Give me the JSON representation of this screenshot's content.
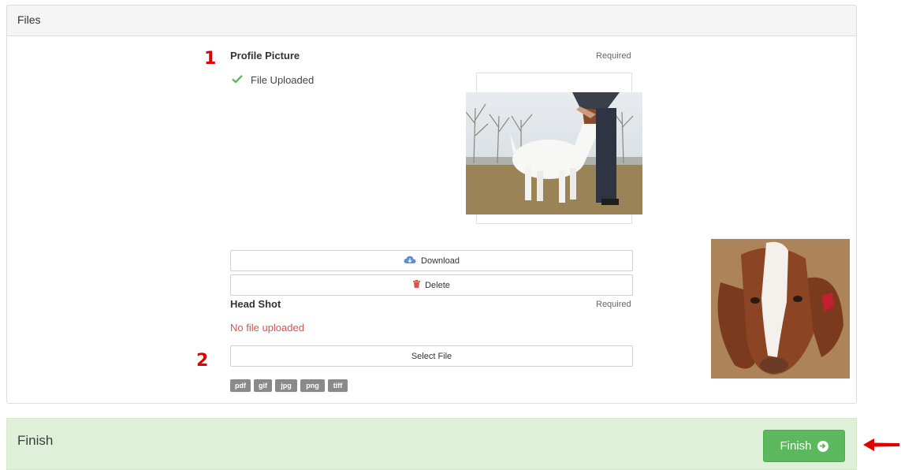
{
  "files_panel": {
    "title": "Files",
    "steps": {
      "one": "1",
      "two": "2"
    },
    "profile_picture": {
      "label": "Profile Picture",
      "required": "Required",
      "status": "File Uploaded",
      "download_label": "Download",
      "delete_label": "Delete"
    },
    "head_shot": {
      "label": "Head Shot",
      "required": "Required",
      "status": "No file uploaded",
      "select_label": "Select File"
    },
    "file_types": [
      "pdf",
      "gif",
      "jpg",
      "png",
      "tiff"
    ]
  },
  "finish_panel": {
    "title": "Finish",
    "button_label": "Finish"
  },
  "colors": {
    "success": "#5cb85c",
    "danger": "#d9534f",
    "finish_bg": "#dff0d8",
    "annotation": "#e00000"
  }
}
